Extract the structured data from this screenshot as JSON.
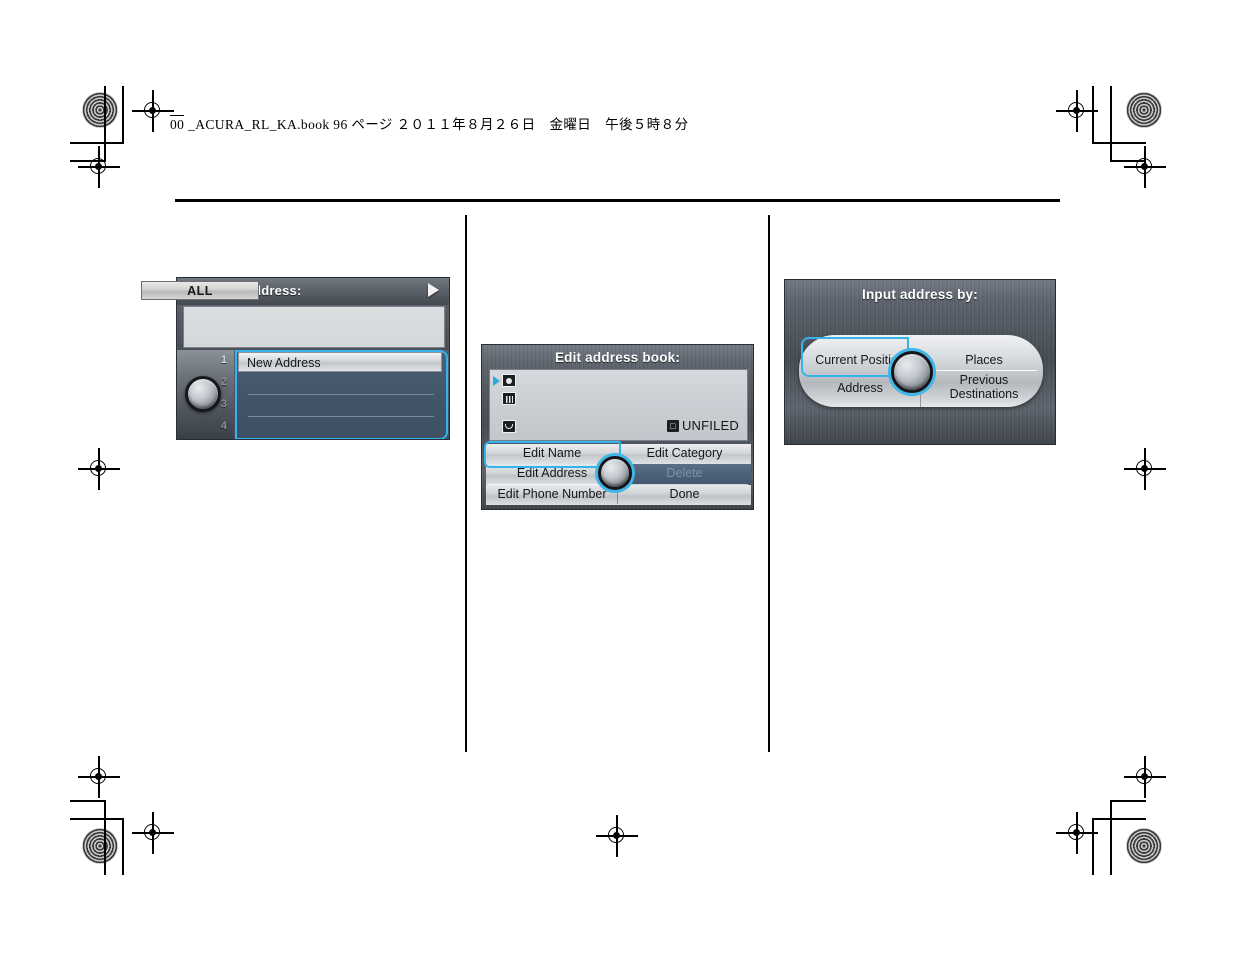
{
  "page": {
    "header_line": "00_ACURA_RL_KA.book   96 ページ   ２０１１年８月２６日　金曜日　午後５時８分",
    "book_prefix": "00",
    "accent_cyan": "#35b4ec",
    "screen_bg": "#4a5058"
  },
  "screens": [
    {
      "id": "select-address",
      "title": "Select an address:",
      "filter_button": "ALL",
      "filter_arrow_icon": "right-triangle-icon",
      "list_indices": [
        "1",
        "2",
        "3",
        "4"
      ],
      "rows": [
        {
          "label": "New Address",
          "selected": true
        },
        {
          "label": "",
          "selected": false
        },
        {
          "label": "",
          "selected": false
        },
        {
          "label": "",
          "selected": false
        }
      ]
    },
    {
      "id": "edit-address-book",
      "title": "Edit address book:",
      "entry_fields": [
        {
          "icon": "name-card-icon",
          "value": "",
          "cursor": true
        },
        {
          "icon": "building-icon",
          "value": "",
          "cursor": false
        },
        {
          "icon": "telephone-icon",
          "value": "",
          "cursor": false
        }
      ],
      "category_badge": "category-icon",
      "category_label": "UNFILED",
      "buttons": [
        {
          "label": "Edit Name",
          "selected": true,
          "disabled": false
        },
        {
          "label": "Edit Category",
          "selected": false,
          "disabled": false
        },
        {
          "label": "Edit Address",
          "selected": false,
          "disabled": false
        },
        {
          "label": "Delete",
          "selected": false,
          "disabled": true
        },
        {
          "label": "Edit Phone Number",
          "selected": false,
          "disabled": false
        },
        {
          "label": "Done",
          "selected": false,
          "disabled": false
        }
      ]
    },
    {
      "id": "input-address-by",
      "title": "Input address by:",
      "options": [
        {
          "label": "Current Position",
          "selected": true
        },
        {
          "label": "Places",
          "selected": false
        },
        {
          "label": "Address",
          "selected": false
        },
        {
          "label": "Previous\nDestinations",
          "selected": false
        }
      ],
      "option_previous_line1": "Previous",
      "option_previous_line2": "Destinations"
    }
  ]
}
